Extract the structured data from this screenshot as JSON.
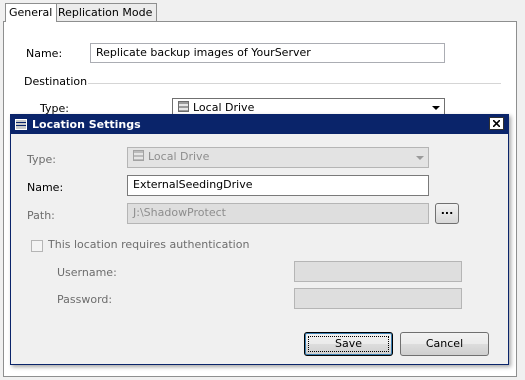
{
  "tabs": [
    {
      "label": "General",
      "active": true
    },
    {
      "label": "Replication Mode",
      "active": false
    }
  ],
  "general": {
    "name_label": "Name:",
    "name_value": "Replicate backup images of YourServer",
    "destination_label": "Destination",
    "type_label": "Type:",
    "type_value": "Local Drive",
    "type_icon": "drive-icon"
  },
  "dialog": {
    "title": "Location Settings",
    "title_icon": "drive-icon",
    "close_icon": "close-icon",
    "type_label": "Type:",
    "type_value": "Local Drive",
    "name_label": "Name:",
    "name_value": "ExternalSeedingDrive",
    "path_label": "Path:",
    "path_value": "J:\\ShadowProtect",
    "browse_label": "...",
    "auth_checkbox_label": "This location requires authentication",
    "auth_checked": false,
    "username_label": "Username:",
    "username_value": "",
    "password_label": "Password:",
    "password_value": "",
    "save_label": "Save",
    "cancel_label": "Cancel"
  },
  "colors": {
    "titlebar": "#0a246a",
    "disabled_text": "#8d8d8d",
    "disabled_field": "#dedede"
  }
}
